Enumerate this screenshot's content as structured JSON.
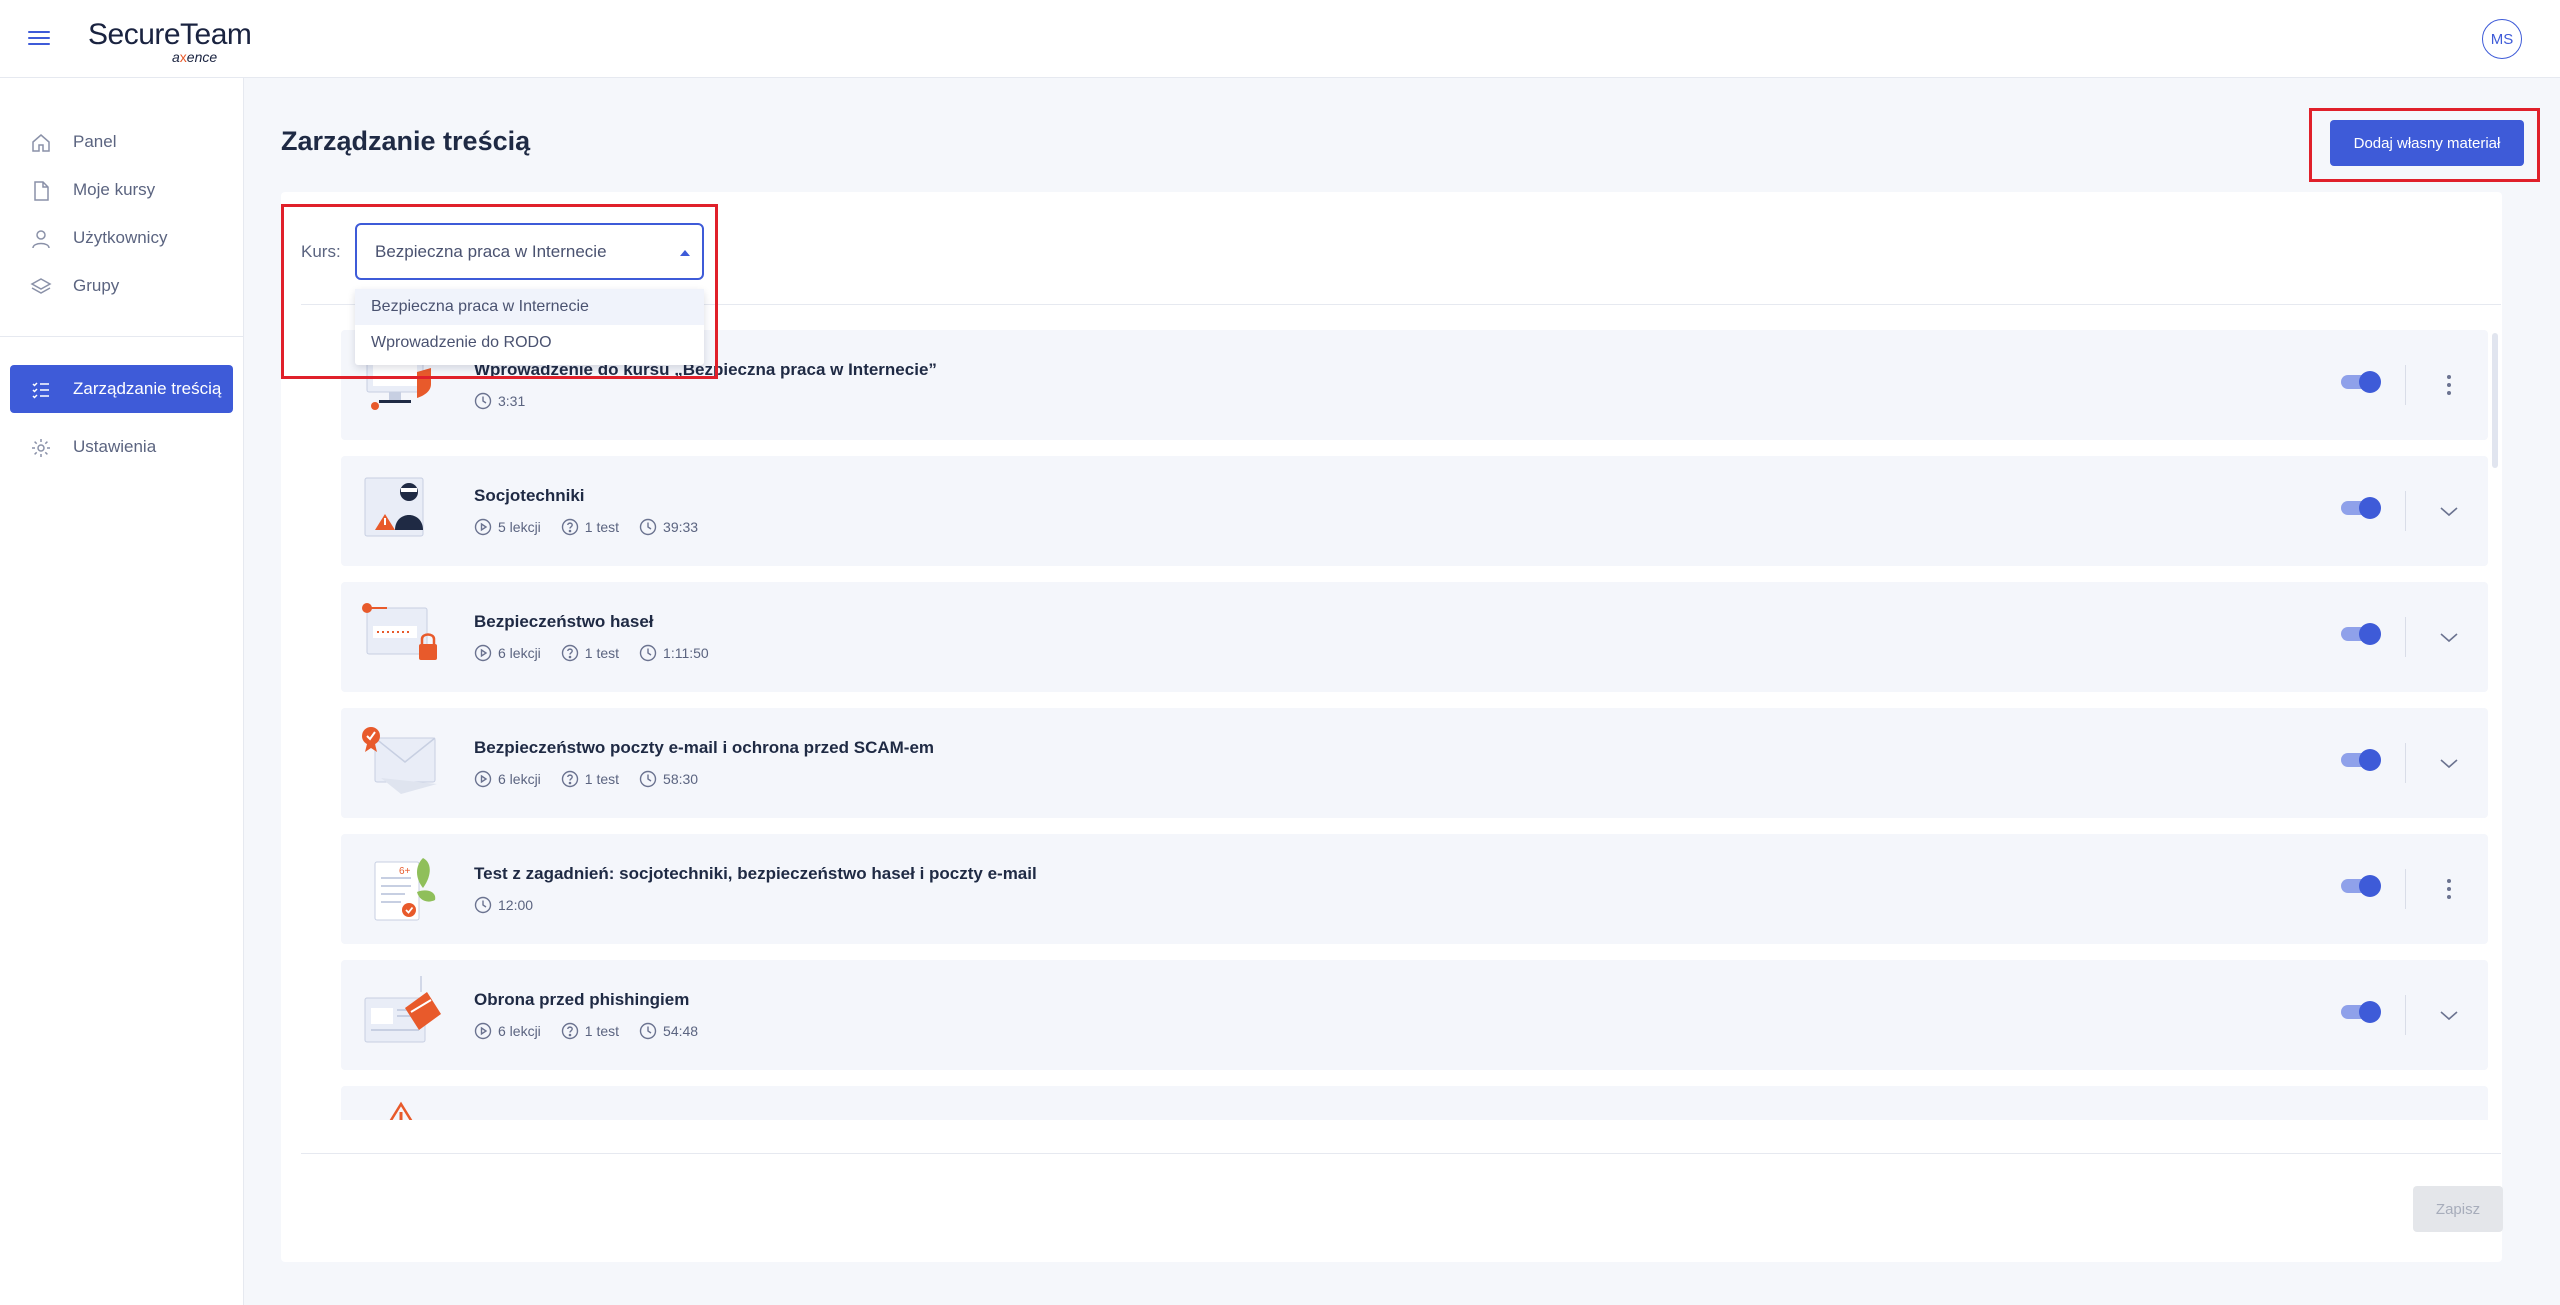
{
  "header": {
    "logo_main": "SecureTeam",
    "logo_sub_pre": "a",
    "logo_sub_o": "x",
    "logo_sub_post": "ence",
    "avatar_initials": "MS"
  },
  "sidebar": {
    "items": [
      {
        "label": "Panel",
        "icon": "home-icon"
      },
      {
        "label": "Moje kursy",
        "icon": "document-icon"
      },
      {
        "label": "Użytkownicy",
        "icon": "user-icon"
      },
      {
        "label": "Grupy",
        "icon": "layers-icon"
      }
    ],
    "items2": [
      {
        "label": "Zarządzanie treścią",
        "icon": "list-check-icon",
        "active": true
      },
      {
        "label": "Ustawienia",
        "icon": "gear-icon"
      }
    ]
  },
  "main": {
    "title": "Zarządzanie treścią",
    "add_button": "Dodaj własny materiał",
    "course_label": "Kurs:",
    "course_selected": "Bezpieczna praca w Internecie",
    "course_options": [
      "Bezpieczna praca w Internecie",
      "Wprowadzenie do RODO"
    ],
    "save_button": "Zapisz"
  },
  "modules": [
    {
      "title": "Wprowadzenie do kursu „Bezpieczna praca w Internecie”",
      "lessons": "",
      "test": "",
      "duration": "3:31",
      "action": "menu",
      "enabled": true
    },
    {
      "title": "Socjotechniki",
      "lessons": "5 lekcji",
      "test": "1 test",
      "duration": "39:33",
      "action": "expand",
      "enabled": true
    },
    {
      "title": "Bezpieczeństwo haseł",
      "lessons": "6 lekcji",
      "test": "1 test",
      "duration": "1:11:50",
      "action": "expand",
      "enabled": true
    },
    {
      "title": "Bezpieczeństwo poczty e-mail i ochrona przed SCAM-em",
      "lessons": "6 lekcji",
      "test": "1 test",
      "duration": "58:30",
      "action": "expand",
      "enabled": true
    },
    {
      "title": "Test z zagadnień: socjotechniki, bezpieczeństwo haseł i poczty e-mail",
      "lessons": "",
      "test": "",
      "duration": "12:00",
      "action": "menu",
      "enabled": true
    },
    {
      "title": "Obrona przed phishingiem",
      "lessons": "6 lekcji",
      "test": "1 test",
      "duration": "54:48",
      "action": "expand",
      "enabled": true
    }
  ],
  "colors": {
    "accent": "#3e5bd8",
    "highlight": "#e0202a",
    "orange": "#e85a2b"
  }
}
